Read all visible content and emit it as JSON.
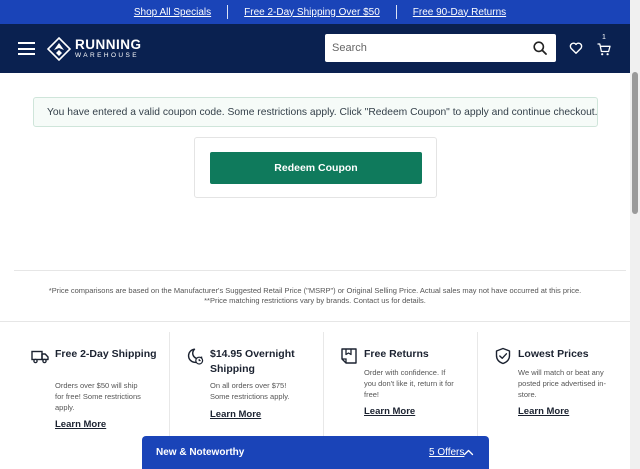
{
  "promo_bar": {
    "links": [
      "Shop All Specials",
      "Free 2-Day Shipping Over $50",
      "Free 90-Day Returns"
    ]
  },
  "header": {
    "logo_word1": "RUNNING",
    "logo_word2": "WAREHOUSE",
    "search_placeholder": "Search",
    "cart_count": "1",
    "icons": [
      "hamburger-menu-icon",
      "search-icon",
      "heart-icon",
      "cart-icon"
    ]
  },
  "notice": {
    "text": "You have entered a valid coupon code. Some restrictions apply. Click \"Redeem Coupon\" to apply and continue checkout."
  },
  "coupon": {
    "button_label": "Redeem Coupon"
  },
  "fine_print": {
    "line1": "*Price comparisons are based on the Manufacturer's Suggested Retail Price (\"MSRP\") or Original Selling Price. Actual sales may not have occurred at this price.",
    "line2": "**Price matching restrictions vary by brands. Contact us for details."
  },
  "features": [
    {
      "icon": "truck-icon",
      "title": "Free 2-Day Shipping",
      "desc": "Orders over $50 will ship for free! Some restrictions apply.",
      "link": "Learn More"
    },
    {
      "icon": "moon-clock-icon",
      "title": "$14.95 Overnight Shipping",
      "desc": "On all orders over $75! Some restrictions apply.",
      "link": "Learn More"
    },
    {
      "icon": "return-box-icon",
      "title": "Free Returns",
      "desc": "Order with confidence. If you don't like it, return it for free!",
      "link": "Learn More"
    },
    {
      "icon": "shield-check-icon",
      "title": "Lowest Prices",
      "desc": "We will match or beat any posted price advertised in-store.",
      "link": "Learn More"
    }
  ],
  "noteworthy": {
    "title": "New & Noteworthy",
    "offers": "5 Offers"
  },
  "colors": {
    "promo_blue": "#1a44b8",
    "header_navy": "#0a2150",
    "button_green": "#0f7a5c"
  }
}
